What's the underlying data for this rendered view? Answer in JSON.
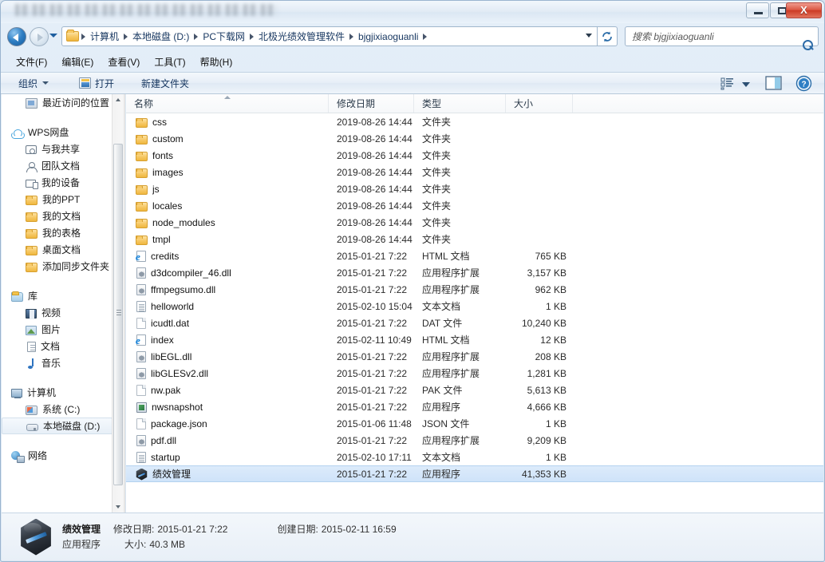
{
  "window": {
    "title_obscured": true,
    "buttons": {
      "minimize": "–",
      "maximize": "□",
      "close": "X"
    }
  },
  "address_bar": {
    "back_tooltip": "后退",
    "forward_tooltip": "前进",
    "breadcrumbs": [
      "计算机",
      "本地磁盘 (D:)",
      "PC下载网",
      "北极光绩效管理软件",
      "bjgjixiaoguanli"
    ],
    "search_placeholder": "搜索 bjgjixiaoguanli",
    "search_value": ""
  },
  "menu": {
    "items": [
      "文件(F)",
      "编辑(E)",
      "查看(V)",
      "工具(T)",
      "帮助(H)"
    ]
  },
  "toolbar": {
    "organize": "组织",
    "open": "打开",
    "new_folder": "新建文件夹"
  },
  "sidebar": {
    "items": [
      {
        "label": "最近访问的位置",
        "icon": "recent-places-icon",
        "indent": 1,
        "selected": false
      },
      {
        "label": "",
        "icon": "gap",
        "indent": 0,
        "selected": false
      },
      {
        "label": "WPS网盘",
        "icon": "cloud-icon",
        "indent": 0,
        "selected": false
      },
      {
        "label": "与我共享",
        "icon": "share-icon",
        "indent": 1,
        "selected": false
      },
      {
        "label": "团队文档",
        "icon": "team-icon",
        "indent": 1,
        "selected": false
      },
      {
        "label": "我的设备",
        "icon": "device-icon",
        "indent": 1,
        "selected": false
      },
      {
        "label": "我的PPT",
        "icon": "folder-icon",
        "indent": 1,
        "selected": false
      },
      {
        "label": "我的文档",
        "icon": "folder-icon",
        "indent": 1,
        "selected": false
      },
      {
        "label": "我的表格",
        "icon": "folder-icon",
        "indent": 1,
        "selected": false
      },
      {
        "label": "桌面文档",
        "icon": "folder-icon",
        "indent": 1,
        "selected": false
      },
      {
        "label": "添加同步文件夹",
        "icon": "folder-icon",
        "indent": 1,
        "selected": false
      },
      {
        "label": "",
        "icon": "gap",
        "indent": 0,
        "selected": false
      },
      {
        "label": "库",
        "icon": "library-icon",
        "indent": 0,
        "selected": false
      },
      {
        "label": "视频",
        "icon": "video-icon",
        "indent": 1,
        "selected": false
      },
      {
        "label": "图片",
        "icon": "picture-icon",
        "indent": 1,
        "selected": false
      },
      {
        "label": "文档",
        "icon": "document-icon",
        "indent": 1,
        "selected": false
      },
      {
        "label": "音乐",
        "icon": "music-icon",
        "indent": 1,
        "selected": false
      },
      {
        "label": "",
        "icon": "gap",
        "indent": 0,
        "selected": false
      },
      {
        "label": "计算机",
        "icon": "computer-icon",
        "indent": 0,
        "selected": false
      },
      {
        "label": "系统 (C:)",
        "icon": "system-drive-icon",
        "indent": 1,
        "selected": false
      },
      {
        "label": "本地磁盘 (D:)",
        "icon": "drive-icon",
        "indent": 1,
        "selected": true
      },
      {
        "label": "",
        "icon": "gap",
        "indent": 0,
        "selected": false
      },
      {
        "label": "网络",
        "icon": "network-icon",
        "indent": 0,
        "selected": false
      }
    ]
  },
  "file_list": {
    "columns": [
      "名称",
      "修改日期",
      "类型",
      "大小"
    ],
    "sort_column": "名称",
    "sort_direction": "asc",
    "rows": [
      {
        "name": "css",
        "date": "2019-08-26 14:44",
        "type": "文件夹",
        "size": "",
        "icon": "folder-icon",
        "selected": false
      },
      {
        "name": "custom",
        "date": "2019-08-26 14:44",
        "type": "文件夹",
        "size": "",
        "icon": "folder-icon",
        "selected": false
      },
      {
        "name": "fonts",
        "date": "2019-08-26 14:44",
        "type": "文件夹",
        "size": "",
        "icon": "folder-icon",
        "selected": false
      },
      {
        "name": "images",
        "date": "2019-08-26 14:44",
        "type": "文件夹",
        "size": "",
        "icon": "folder-icon",
        "selected": false
      },
      {
        "name": "js",
        "date": "2019-08-26 14:44",
        "type": "文件夹",
        "size": "",
        "icon": "folder-icon",
        "selected": false
      },
      {
        "name": "locales",
        "date": "2019-08-26 14:44",
        "type": "文件夹",
        "size": "",
        "icon": "folder-icon",
        "selected": false
      },
      {
        "name": "node_modules",
        "date": "2019-08-26 14:44",
        "type": "文件夹",
        "size": "",
        "icon": "folder-icon",
        "selected": false
      },
      {
        "name": "tmpl",
        "date": "2019-08-26 14:44",
        "type": "文件夹",
        "size": "",
        "icon": "folder-icon",
        "selected": false
      },
      {
        "name": "credits",
        "date": "2015-01-21 7:22",
        "type": "HTML 文档",
        "size": "765 KB",
        "icon": "html-icon",
        "selected": false
      },
      {
        "name": "d3dcompiler_46.dll",
        "date": "2015-01-21 7:22",
        "type": "应用程序扩展",
        "size": "3,157 KB",
        "icon": "dll-icon",
        "selected": false
      },
      {
        "name": "ffmpegsumo.dll",
        "date": "2015-01-21 7:22",
        "type": "应用程序扩展",
        "size": "962 KB",
        "icon": "dll-icon",
        "selected": false
      },
      {
        "name": "helloworld",
        "date": "2015-02-10 15:04",
        "type": "文本文档",
        "size": "1 KB",
        "icon": "text-icon",
        "selected": false
      },
      {
        "name": "icudtl.dat",
        "date": "2015-01-21 7:22",
        "type": "DAT 文件",
        "size": "10,240 KB",
        "icon": "blank-icon",
        "selected": false
      },
      {
        "name": "index",
        "date": "2015-02-11 10:49",
        "type": "HTML 文档",
        "size": "12 KB",
        "icon": "html-icon",
        "selected": false
      },
      {
        "name": "libEGL.dll",
        "date": "2015-01-21 7:22",
        "type": "应用程序扩展",
        "size": "208 KB",
        "icon": "dll-icon",
        "selected": false
      },
      {
        "name": "libGLESv2.dll",
        "date": "2015-01-21 7:22",
        "type": "应用程序扩展",
        "size": "1,281 KB",
        "icon": "dll-icon",
        "selected": false
      },
      {
        "name": "nw.pak",
        "date": "2015-01-21 7:22",
        "type": "PAK 文件",
        "size": "5,613 KB",
        "icon": "blank-icon",
        "selected": false
      },
      {
        "name": "nwsnapshot",
        "date": "2015-01-21 7:22",
        "type": "应用程序",
        "size": "4,666 KB",
        "icon": "exe-icon",
        "selected": false
      },
      {
        "name": "package.json",
        "date": "2015-01-06 11:48",
        "type": "JSON 文件",
        "size": "1 KB",
        "icon": "blank-icon",
        "selected": false
      },
      {
        "name": "pdf.dll",
        "date": "2015-01-21 7:22",
        "type": "应用程序扩展",
        "size": "9,209 KB",
        "icon": "dll-icon",
        "selected": false
      },
      {
        "name": "startup",
        "date": "2015-02-10 17:11",
        "type": "文本文档",
        "size": "1 KB",
        "icon": "text-icon",
        "selected": false
      },
      {
        "name": "绩效管理",
        "date": "2015-01-21 7:22",
        "type": "应用程序",
        "size": "41,353 KB",
        "icon": "app-icon",
        "selected": true
      }
    ]
  },
  "details_pane": {
    "name": "绩效管理",
    "type": "应用程序",
    "modified_label": "修改日期:",
    "modified_value": "2015-01-21 7:22",
    "created_label": "创建日期:",
    "created_value": "2015-02-11 16:59",
    "size_label": "大小:",
    "size_value": "40.3 MB"
  },
  "colors": {
    "selection": "#cfe3f9",
    "accent": "#15355f",
    "close_button": "#cc3c26"
  }
}
